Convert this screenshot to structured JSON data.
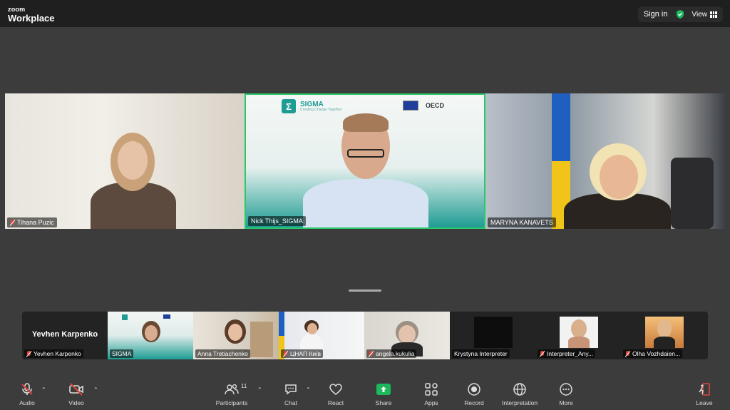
{
  "app": {
    "brand_small": "zoom",
    "brand_large": "Workplace",
    "sign_in": "Sign in",
    "view": "View"
  },
  "main_tiles": [
    {
      "name": "Tihana Puzic",
      "muted": true
    },
    {
      "name": "Nick Thijs_SIGMA",
      "muted": false,
      "active_speaker": true
    },
    {
      "name": "MARYNA KANAVETS",
      "muted": false
    }
  ],
  "nick_background": {
    "logo_letter": "Σ",
    "logo_title": "SIGMA",
    "logo_tagline": "Creating Change Together",
    "partner": "OECD"
  },
  "thumbnails": [
    {
      "name": "Yevhen Karpenko",
      "big_label": "Yevhen Karpenko",
      "muted": true,
      "video": false
    },
    {
      "name": "SIGMA",
      "muted": false,
      "video": true
    },
    {
      "name": "Anna Tretiachenko",
      "muted": false,
      "video": true
    },
    {
      "name": "ЦНАП Київ",
      "muted": true,
      "video": true
    },
    {
      "name": "angela.kukulia",
      "muted": true,
      "video": true
    },
    {
      "name": "Krystyna Interpreter",
      "muted": false,
      "video": true
    },
    {
      "name": "Interpreter_Any...",
      "muted": true,
      "video": true
    },
    {
      "name": "Olha Vozhdaien...",
      "muted": true,
      "video": true
    }
  ],
  "toolbar": {
    "audio": "Audio",
    "video": "Video",
    "participants": "Participants",
    "participants_count": "11",
    "chat": "Chat",
    "react": "React",
    "share": "Share",
    "apps": "Apps",
    "record": "Record",
    "interpretation": "Interpretation",
    "more": "More",
    "leave": "Leave"
  },
  "colors": {
    "active_speaker_border": "#2ac86a",
    "share_green": "#1cb85c",
    "mute_red": "#e0463c",
    "sigma_teal": "#1e9c93"
  }
}
